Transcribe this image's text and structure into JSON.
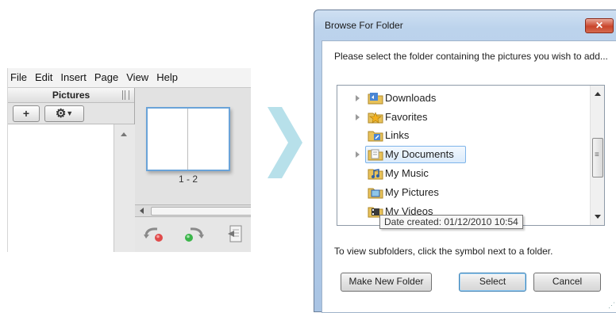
{
  "app": {
    "menu": [
      "File",
      "Edit",
      "Insert",
      "Page",
      "View",
      "Help"
    ],
    "panel_title": "Pictures",
    "add_button": "+",
    "page_label": "1 - 2"
  },
  "dialog": {
    "title": "Browse For Folder",
    "close_label": "✕",
    "prompt": "Please select the folder containing the pictures you wish to add...",
    "folders": [
      {
        "label": "Downloads",
        "expandable": true
      },
      {
        "label": "Favorites",
        "expandable": true
      },
      {
        "label": "Links",
        "expandable": false
      },
      {
        "label": "My Documents",
        "expandable": true,
        "selected": true
      },
      {
        "label": "My Music",
        "expandable": false
      },
      {
        "label": "My Pictures",
        "expandable": false
      },
      {
        "label": "My Videos",
        "expandable": false
      }
    ],
    "tooltip": "Date created: 01/12/2010 10:54",
    "hint": "To view subfolders, click the symbol next to a folder.",
    "buttons": {
      "make_new_folder": "Make New Folder",
      "select": "Select",
      "cancel": "Cancel"
    }
  },
  "colors": {
    "arrow": "#b7e0ea",
    "dialog_frame": "#b3cbe8",
    "selection": "#7eb4ea",
    "close_button": "#c9452b"
  }
}
